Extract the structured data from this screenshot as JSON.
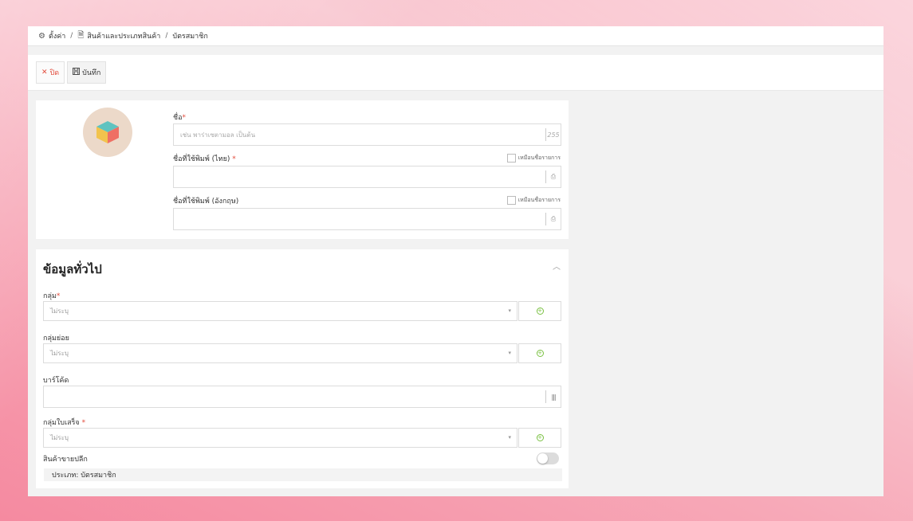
{
  "breadcrumb": {
    "settings_label": "ตั้งค่า",
    "products_label": "สินค้าและประเภทสินค้า",
    "current_label": "บัตรสมาชิก"
  },
  "toolbar": {
    "close_label": "ปิด",
    "save_label": "บันทึก"
  },
  "top_form": {
    "name": {
      "label": "ชื่อ",
      "required_mark": "*",
      "placeholder": "เช่น พาร่าเซตามอล เป็นต้น",
      "counter": "255",
      "value": ""
    },
    "print_name_th": {
      "label": "ชื่อที่ใช้พิมพ์ (ไทย)",
      "required_mark": "*",
      "checkbox_label": "เหมือนชื่อรายการ",
      "value": ""
    },
    "print_name_en": {
      "label": "ชื่อที่ใช้พิมพ์ (อังกฤษ)",
      "checkbox_label": "เหมือนชื่อรายการ",
      "value": ""
    }
  },
  "general": {
    "title": "ข้อมูลทั่วไป",
    "group": {
      "label": "กลุ่ม",
      "required_mark": "*",
      "selected": "ไม่ระบุ"
    },
    "subgroup": {
      "label": "กลุ่มย่อย",
      "selected": "ไม่ระบุ"
    },
    "barcode": {
      "label": "บาร์โค้ด",
      "value": ""
    },
    "receipt_group": {
      "label": "กลุ่มใบเสร็จ",
      "required_mark": "*",
      "selected": "ไม่ระบุ"
    },
    "retail": {
      "label": "สินค้าขายปลีก",
      "enabled": false
    },
    "type_text": "ประเภท: บัตรสมาชิก"
  },
  "colors": {
    "accent_red": "#e24b3b",
    "add_green": "#7ac142"
  }
}
